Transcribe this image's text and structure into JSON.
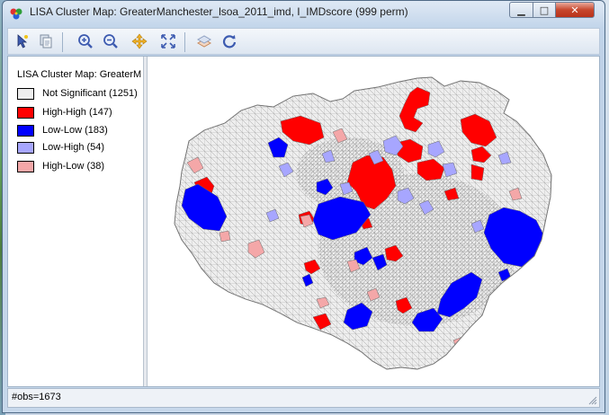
{
  "window": {
    "title": "LISA Cluster Map: GreaterManchester_lsoa_2011_imd, I_IMDscore (999 perm)"
  },
  "titlebar_controls": [
    {
      "name": "minimize-button",
      "glyph": "▁"
    },
    {
      "name": "maximize-button",
      "glyph": "□"
    },
    {
      "name": "close-button",
      "glyph": "✕"
    }
  ],
  "toolbar": {
    "items": [
      "select-icon",
      "copy-map-icon",
      "zoom-in-icon",
      "zoom-out-icon",
      "pan-icon",
      "fit-extent-icon",
      "layer-icon",
      "refresh-icon"
    ]
  },
  "legend": {
    "title": "LISA Cluster Map: GreaterM",
    "items": [
      {
        "label": "Not Significant (1251)",
        "color": "#eeeeee"
      },
      {
        "label": "High-High (147)",
        "color": "#ff0000"
      },
      {
        "label": "Low-Low (183)",
        "color": "#0000ff"
      },
      {
        "label": "Low-High (54)",
        "color": "#a7a6ff"
      },
      {
        "label": "High-Low (38)",
        "color": "#f4a7a8"
      }
    ]
  },
  "map": {
    "colors": {
      "not_significant": "#eeeeee",
      "high_high": "#ff0000",
      "low_low": "#0000ff",
      "low_high": "#a7a6ff",
      "high_low": "#f4a7a8",
      "boundary": "#8a8a8a"
    }
  },
  "status": {
    "text": "#obs=1673"
  }
}
